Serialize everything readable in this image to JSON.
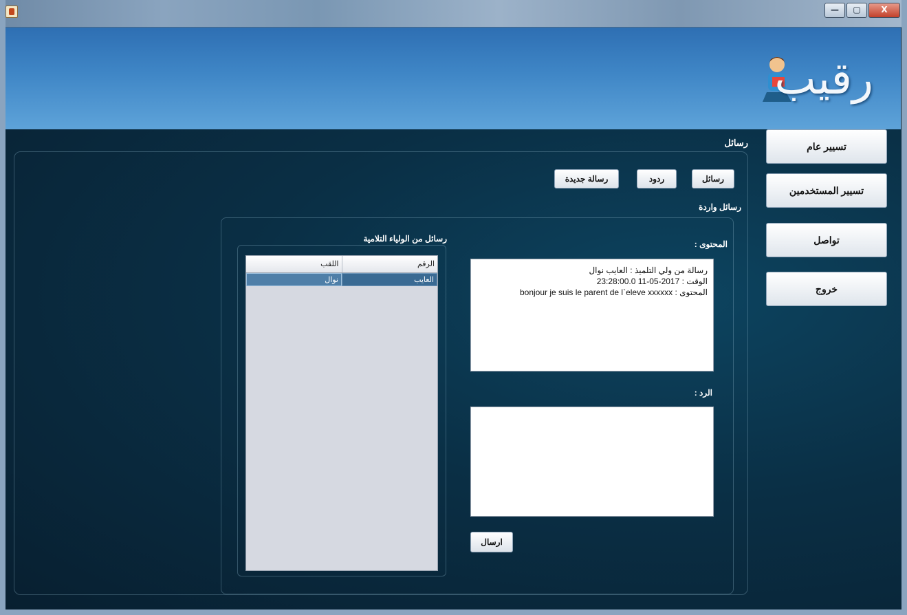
{
  "window": {
    "title": "",
    "controls": {
      "minimize": "—",
      "maximize": "▢",
      "close": "X"
    }
  },
  "brand": {
    "logo_text": "رقيب",
    "logo_icon": "reading-student-icon"
  },
  "sidebar": {
    "items": [
      {
        "label": "تسيير عام"
      },
      {
        "label": "تسيير المستخدمين"
      },
      {
        "label": "تواصل"
      },
      {
        "label": "خروج"
      }
    ]
  },
  "section": {
    "title": "رسائل"
  },
  "tabs": [
    {
      "label": "رسائل"
    },
    {
      "label": "ردود"
    },
    {
      "label": "رسالة جديدة"
    }
  ],
  "inbox": {
    "subtitle": "رسائل واردة",
    "list_title": "رسائل من الولياء التلامية",
    "columns": [
      "اللقب",
      "الرقم"
    ],
    "rows": [
      {
        "cells": [
          "نوال",
          "العايب"
        ]
      }
    ]
  },
  "message": {
    "content_label": "المحتوى :",
    "content_lines": [
      "رسالة من ولي التلميذ : العايب نوال",
      "الوقت : 2017-05-11 23:28:00.0",
      "المحتوى : bonjour je suis le parent de l`eleve xxxxxx"
    ],
    "reply_label": "الرد :",
    "reply_value": "",
    "send_label": "ارسال"
  },
  "colors": {
    "header_blue": "#3f86c6",
    "main_dark": "#0a2f45",
    "selection": "#3a6a93"
  }
}
